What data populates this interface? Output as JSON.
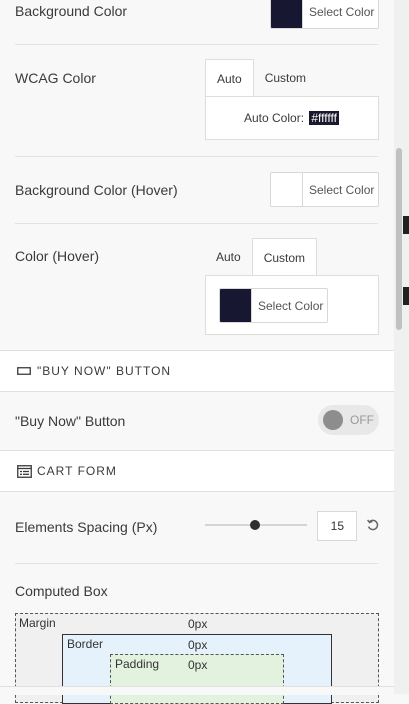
{
  "rows": {
    "background_color": {
      "label": "Background Color",
      "picker_label": "Select Color",
      "swatch": "#171731"
    },
    "wcag_color": {
      "label": "WCAG Color",
      "tabs": [
        {
          "label": "Auto"
        },
        {
          "label": "Custom"
        }
      ],
      "active_tab": "Auto",
      "auto_prefix": "Auto Color:",
      "auto_value": "#ffffff"
    },
    "background_color_hover": {
      "label": "Background Color (Hover)",
      "picker_label": "Select Color",
      "swatch": "#ffffff"
    },
    "color_hover": {
      "label": "Color (Hover)",
      "tabs": [
        {
          "label": "Auto"
        },
        {
          "label": "Custom"
        }
      ],
      "active_tab": "Custom",
      "picker_label": "Select Color",
      "swatch": "#171731"
    }
  },
  "buy_now_section": {
    "title": "\"BUY NOW\" BUTTON",
    "icon": "button-icon",
    "toggle_label": "\"Buy Now\" Button",
    "toggle_state": "OFF"
  },
  "cart_form_section": {
    "title": "CART FORM",
    "icon": "form-icon",
    "spacing_label": "Elements Spacing (Px)",
    "spacing_value": "15",
    "spacing_slider_fraction": 0.5
  },
  "computed_box": {
    "label": "Computed Box",
    "margin": {
      "label": "Margin",
      "value": "0px"
    },
    "border": {
      "label": "Border",
      "value": "0px"
    },
    "padding": {
      "label": "Padding",
      "value": "0px"
    }
  },
  "colors": {
    "dark_swatch": "#171731",
    "border_box_bg": "#e5f1fb",
    "padding_box_bg": "#e3f2df"
  }
}
